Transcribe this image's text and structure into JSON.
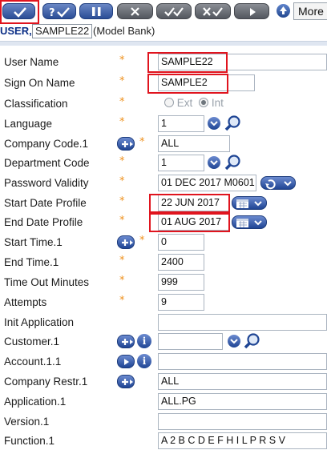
{
  "toolbar": {
    "buttons": [
      {
        "name": "commit",
        "icon": "check-icon"
      },
      {
        "name": "validate",
        "icon": "question-check-icon"
      },
      {
        "name": "hold",
        "icon": "pause-icon"
      },
      {
        "name": "delete",
        "icon": "x-icon"
      },
      {
        "name": "authorise",
        "icon": "double-check-icon"
      },
      {
        "name": "reverse",
        "icon": "x-check-icon"
      },
      {
        "name": "audit",
        "icon": "arrow-right-icon"
      },
      {
        "name": "expand",
        "icon": "up-arrow-icon"
      }
    ],
    "more_label": "More"
  },
  "header": {
    "application": "USER,",
    "record_id": "SAMPLE22",
    "description": "(Model Bank)"
  },
  "mandatory_marker": "*",
  "fields": [
    {
      "label": "User Name",
      "value": "SAMPLE22"
    },
    {
      "label": "Sign On Name",
      "value": "SAMPLE2"
    },
    {
      "label": "Classification",
      "options": [
        "Ext",
        "Int"
      ],
      "selected": "Int"
    },
    {
      "label": "Language",
      "value": "1"
    },
    {
      "label": "Company Code.1",
      "value": "ALL"
    },
    {
      "label": "Department Code",
      "value": "1"
    },
    {
      "label": "Password Validity",
      "value": "01 DEC 2017 M0601"
    },
    {
      "label": "Start Date Profile",
      "value": "22 JUN 2017"
    },
    {
      "label": "End Date Profile",
      "value": "01 AUG 2017"
    },
    {
      "label": "Start Time.1",
      "value": "0"
    },
    {
      "label": "End Time.1",
      "value": "2400"
    },
    {
      "label": "Time Out Minutes",
      "value": "999"
    },
    {
      "label": "Attempts",
      "value": "9"
    },
    {
      "label": "Init Application",
      "value": ""
    },
    {
      "label": "Customer.1",
      "value": ""
    },
    {
      "label": "Account.1.1",
      "value": ""
    },
    {
      "label": "Company Restr.1",
      "value": "ALL"
    },
    {
      "label": "Application.1",
      "value": "ALL.PG"
    },
    {
      "label": "Version.1",
      "value": ""
    },
    {
      "label": "Function.1",
      "value": "A 2 B C D E F H I L P R S V"
    }
  ],
  "colors": {
    "button_blue": "#2a4d96",
    "button_grey": "#53575f",
    "mandatory_star": "#ee8f1a",
    "highlight_red": "#e0141e",
    "header_blue": "#0b2e86"
  }
}
